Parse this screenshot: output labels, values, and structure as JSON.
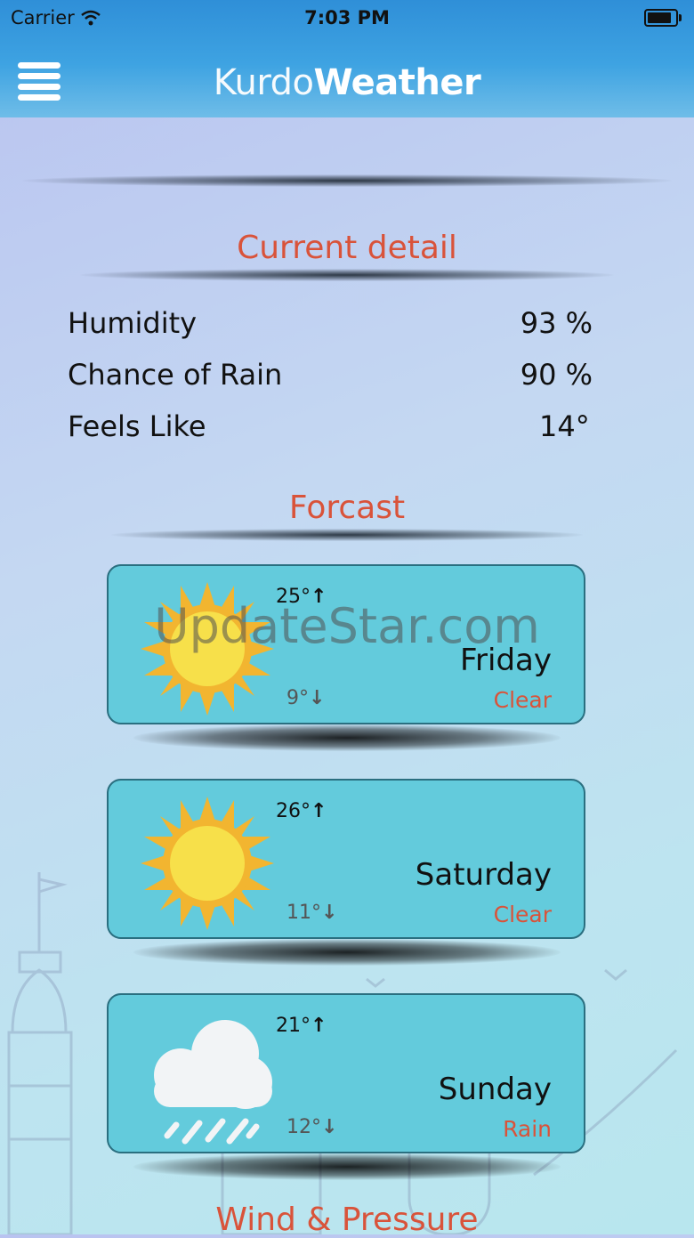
{
  "status_bar": {
    "carrier": "Carrier",
    "time": "7:03 PM"
  },
  "header": {
    "title_part1": "Kurdo",
    "title_part2": "Weather"
  },
  "current_detail": {
    "title": "Current detail",
    "rows": [
      {
        "label": "Humidity",
        "value": "93 %"
      },
      {
        "label": "Chance of Rain",
        "value": "90 %"
      },
      {
        "label": "Feels Like",
        "value": "14°"
      }
    ]
  },
  "forecast": {
    "title": "Forcast",
    "days": [
      {
        "high": "25°",
        "low": "9°",
        "day": "Friday",
        "condition": "Clear",
        "icon": "sun-icon"
      },
      {
        "high": "26°",
        "low": "11°",
        "day": "Saturday",
        "condition": "Clear",
        "icon": "sun-icon"
      },
      {
        "high": "21°",
        "low": "12°",
        "day": "Sunday",
        "condition": "Rain",
        "icon": "rain-cloud-icon"
      }
    ]
  },
  "wind_pressure": {
    "title": "Wind & Pressure"
  },
  "watermark": "UpdateStar.com",
  "colors": {
    "accent": "#d9533a",
    "card": "#63cbdc",
    "header": "#3ea3e2"
  }
}
